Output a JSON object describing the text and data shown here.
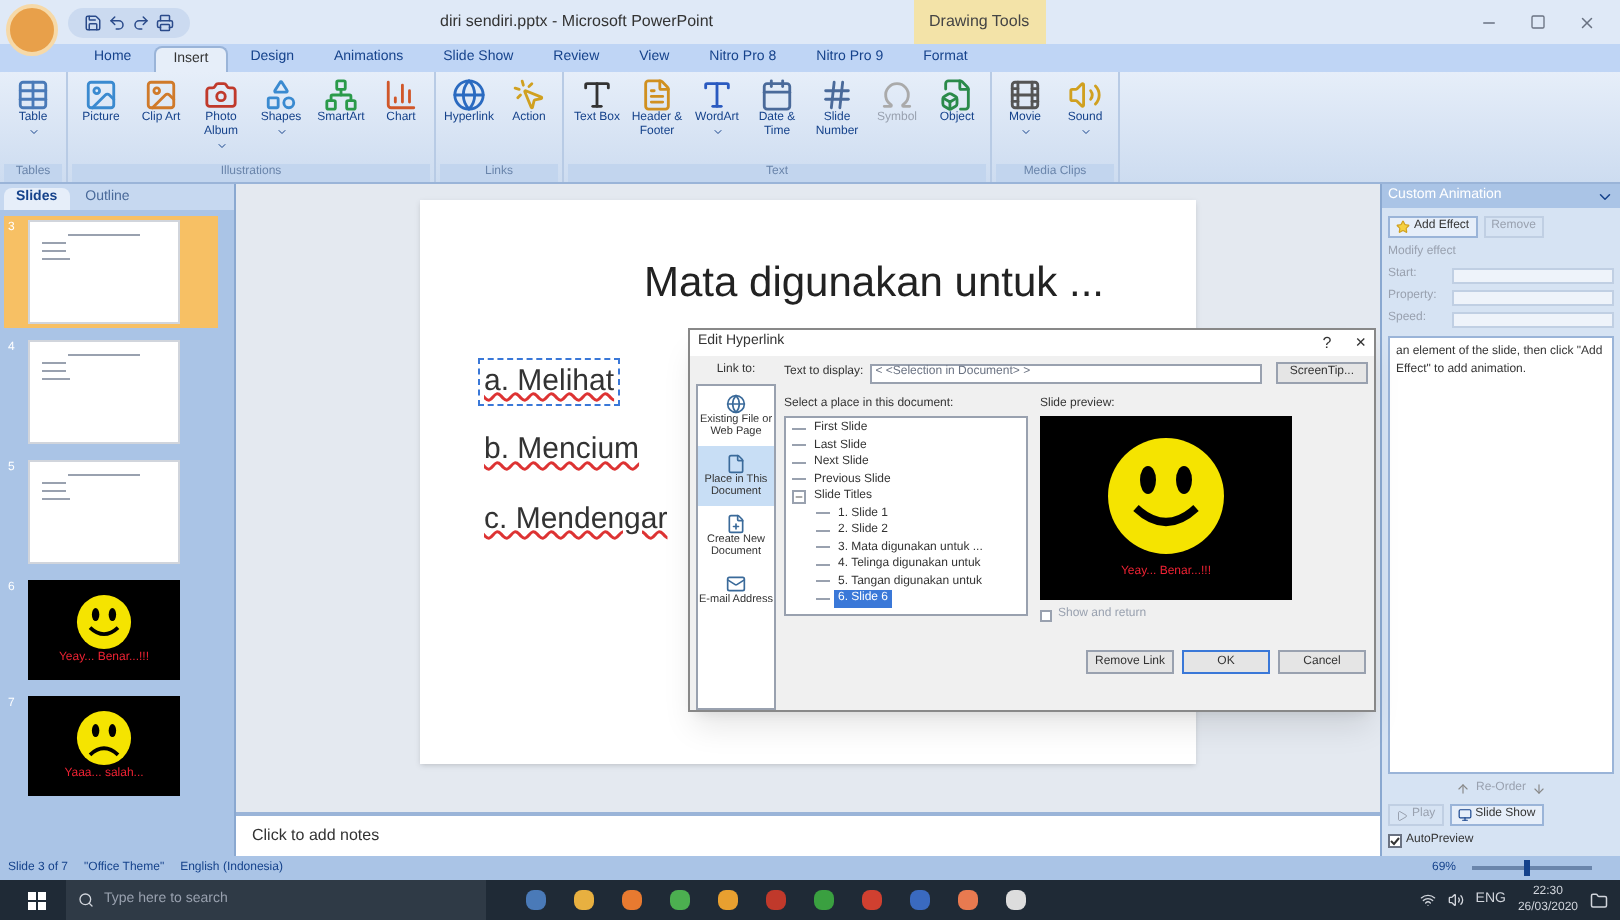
{
  "window": {
    "title": "diri sendiri.pptx - Microsoft PowerPoint",
    "context_tab": "Drawing Tools"
  },
  "tabs": [
    {
      "label": "Home",
      "selected": false
    },
    {
      "label": "Insert",
      "selected": true
    },
    {
      "label": "Design",
      "selected": false
    },
    {
      "label": "Animations",
      "selected": false
    },
    {
      "label": "Slide Show",
      "selected": false
    },
    {
      "label": "Review",
      "selected": false
    },
    {
      "label": "View",
      "selected": false
    },
    {
      "label": "Nitro Pro 8",
      "selected": false
    },
    {
      "label": "Nitro Pro 9",
      "selected": false
    },
    {
      "label": "Format",
      "selected": false
    }
  ],
  "ribbon": [
    {
      "label": "Tables",
      "buttons": [
        {
          "label": "Table",
          "dropdown": true,
          "disabled": false
        }
      ]
    },
    {
      "label": "Illustrations",
      "buttons": [
        {
          "label": "Picture",
          "dropdown": false,
          "disabled": false
        },
        {
          "label": "Clip Art",
          "dropdown": false,
          "disabled": false
        },
        {
          "label": "Photo Album",
          "dropdown": true,
          "disabled": false
        },
        {
          "label": "Shapes",
          "dropdown": true,
          "disabled": false
        },
        {
          "label": "SmartArt",
          "dropdown": false,
          "disabled": false
        },
        {
          "label": "Chart",
          "dropdown": false,
          "disabled": false
        }
      ]
    },
    {
      "label": "Links",
      "buttons": [
        {
          "label": "Hyperlink",
          "dropdown": false,
          "disabled": false
        },
        {
          "label": "Action",
          "dropdown": false,
          "disabled": false
        }
      ]
    },
    {
      "label": "Text",
      "buttons": [
        {
          "label": "Text Box",
          "dropdown": false,
          "disabled": false
        },
        {
          "label": "Header & Footer",
          "dropdown": false,
          "disabled": false
        },
        {
          "label": "WordArt",
          "dropdown": true,
          "disabled": false
        },
        {
          "label": "Date & Time",
          "dropdown": false,
          "disabled": false
        },
        {
          "label": "Slide Number",
          "dropdown": false,
          "disabled": false
        },
        {
          "label": "Symbol",
          "dropdown": false,
          "disabled": true
        },
        {
          "label": "Object",
          "dropdown": false,
          "disabled": false
        }
      ]
    },
    {
      "label": "Media Clips",
      "buttons": [
        {
          "label": "Movie",
          "dropdown": true,
          "disabled": false
        },
        {
          "label": "Sound",
          "dropdown": true,
          "disabled": false
        }
      ]
    }
  ],
  "pane_tabs": [
    {
      "label": "Slides",
      "selected": true
    },
    {
      "label": "Outline",
      "selected": false
    }
  ],
  "thumbnails": [
    {
      "number": "3",
      "kind": "text",
      "selected": true
    },
    {
      "number": "4",
      "kind": "text",
      "selected": false
    },
    {
      "number": "5",
      "kind": "text",
      "selected": false
    },
    {
      "number": "6",
      "kind": "happy",
      "selected": false,
      "caption": "Yeay... Benar...!!!"
    },
    {
      "number": "7",
      "kind": "sad",
      "selected": false,
      "caption": "Yaaa... salah..."
    }
  ],
  "slide": {
    "title": "Mata digunakan untuk ...",
    "items": [
      {
        "text": "a. Melihat",
        "selected": true
      },
      {
        "text": "b. Mencium",
        "selected": false
      },
      {
        "text": "c. Mendengar",
        "selected": false
      }
    ]
  },
  "notes": {
    "placeholder": "Click to add notes"
  },
  "dialog": {
    "title": "Edit Hyperlink",
    "help": "?",
    "close": "×",
    "link_to_label": "Link to:",
    "link_to": [
      {
        "label": "Existing File or Web Page",
        "selected": false
      },
      {
        "label": "Place in This Document",
        "selected": true
      },
      {
        "label": "Create New Document",
        "selected": false
      },
      {
        "label": "E-mail Address",
        "selected": false
      }
    ],
    "text_to_display_label": "Text to display:",
    "text_to_display": "< <Selection in Document> >",
    "screentip": "ScreenTip...",
    "place_label": "Select a place in this document:",
    "places": [
      {
        "label": "First Slide",
        "selected": false
      },
      {
        "label": "Last Slide",
        "selected": false
      },
      {
        "label": "Next Slide",
        "selected": false
      },
      {
        "label": "Previous Slide",
        "selected": false
      },
      {
        "label": "Slide Titles",
        "selected": false,
        "expanded": true,
        "children": [
          {
            "label": "1. Slide 1",
            "selected": false
          },
          {
            "label": "2. Slide 2",
            "selected": false
          },
          {
            "label": "3. Mata digunakan untuk ...",
            "selected": false
          },
          {
            "label": "4. Telinga digunakan untuk",
            "selected": false
          },
          {
            "label": "5. Tangan digunakan untuk",
            "selected": false
          },
          {
            "label": "6. Slide 6",
            "selected": true
          }
        ]
      }
    ],
    "preview_label": "Slide preview:",
    "preview_caption": "Yeay... Benar...!!!",
    "show_and_return": {
      "label": "Show and return",
      "checked": false
    },
    "buttons": [
      {
        "label": "Remove Link",
        "kind": "remove"
      },
      {
        "label": "OK",
        "kind": "ok"
      },
      {
        "label": "Cancel",
        "kind": "cancel"
      }
    ]
  },
  "animation_pane": {
    "title": "Custom Animation",
    "add_effect": "Add Effect",
    "remove": "Remove",
    "modify_label": "Modify effect",
    "fields": [
      {
        "label": "Start:"
      },
      {
        "label": "Property:"
      },
      {
        "label": "Speed:"
      }
    ],
    "hint": "an element of the slide, then click \"Add Effect\" to add animation.",
    "reorder": "Re-Order",
    "play": "Play",
    "slide_show": "Slide Show",
    "autopreview": {
      "label": "AutoPreview",
      "checked": true
    }
  },
  "status_bar": {
    "slide": "Slide 3 of 7",
    "theme": "\"Office Theme\"",
    "language": "English (Indonesia)",
    "zoom": "69%",
    "zoom_slider": {
      "level": 0.45
    }
  },
  "taskbar": {
    "search_placeholder": "Type here to search",
    "language": "ENG",
    "time": "22:30",
    "date": "26/03/2020"
  }
}
